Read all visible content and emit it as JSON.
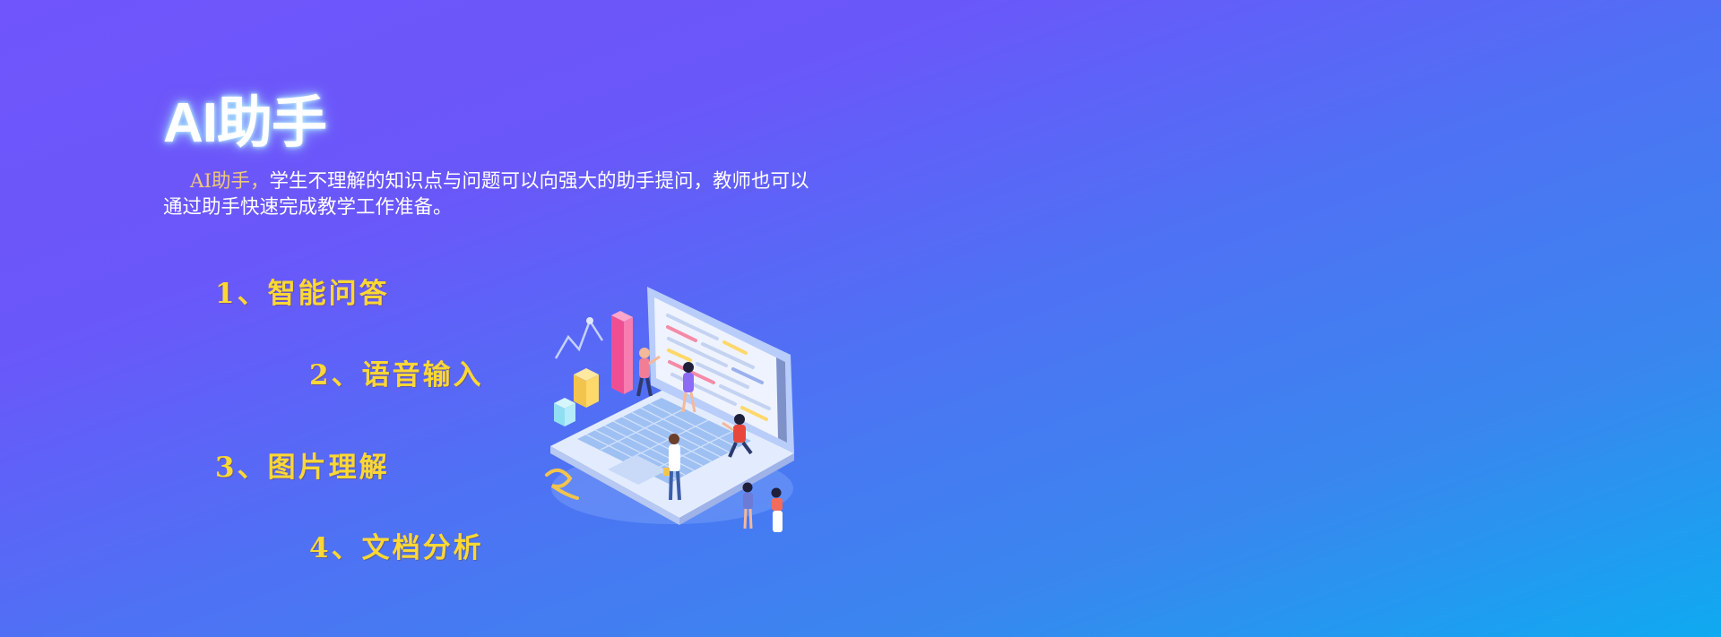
{
  "banner": {
    "title": "AI助手",
    "description_lead": "AI助手，",
    "description_body": "学生不理解的知识点与问题可以向强大的助手提问，教师也可以通过助手快速完成教学工作准备。",
    "features": [
      {
        "label": "1、智能问答"
      },
      {
        "label": "2、语音输入"
      },
      {
        "label": "3、图片理解"
      },
      {
        "label": "4、文档分析"
      }
    ],
    "illustration_icon": "laptop-team-illustration",
    "colors": {
      "background_start": "#6f55fb",
      "background_end": "#0faaf0",
      "feature_text": "#fcd735",
      "lead_text": "#f0c878",
      "title_glow": "#9be4ff"
    }
  }
}
